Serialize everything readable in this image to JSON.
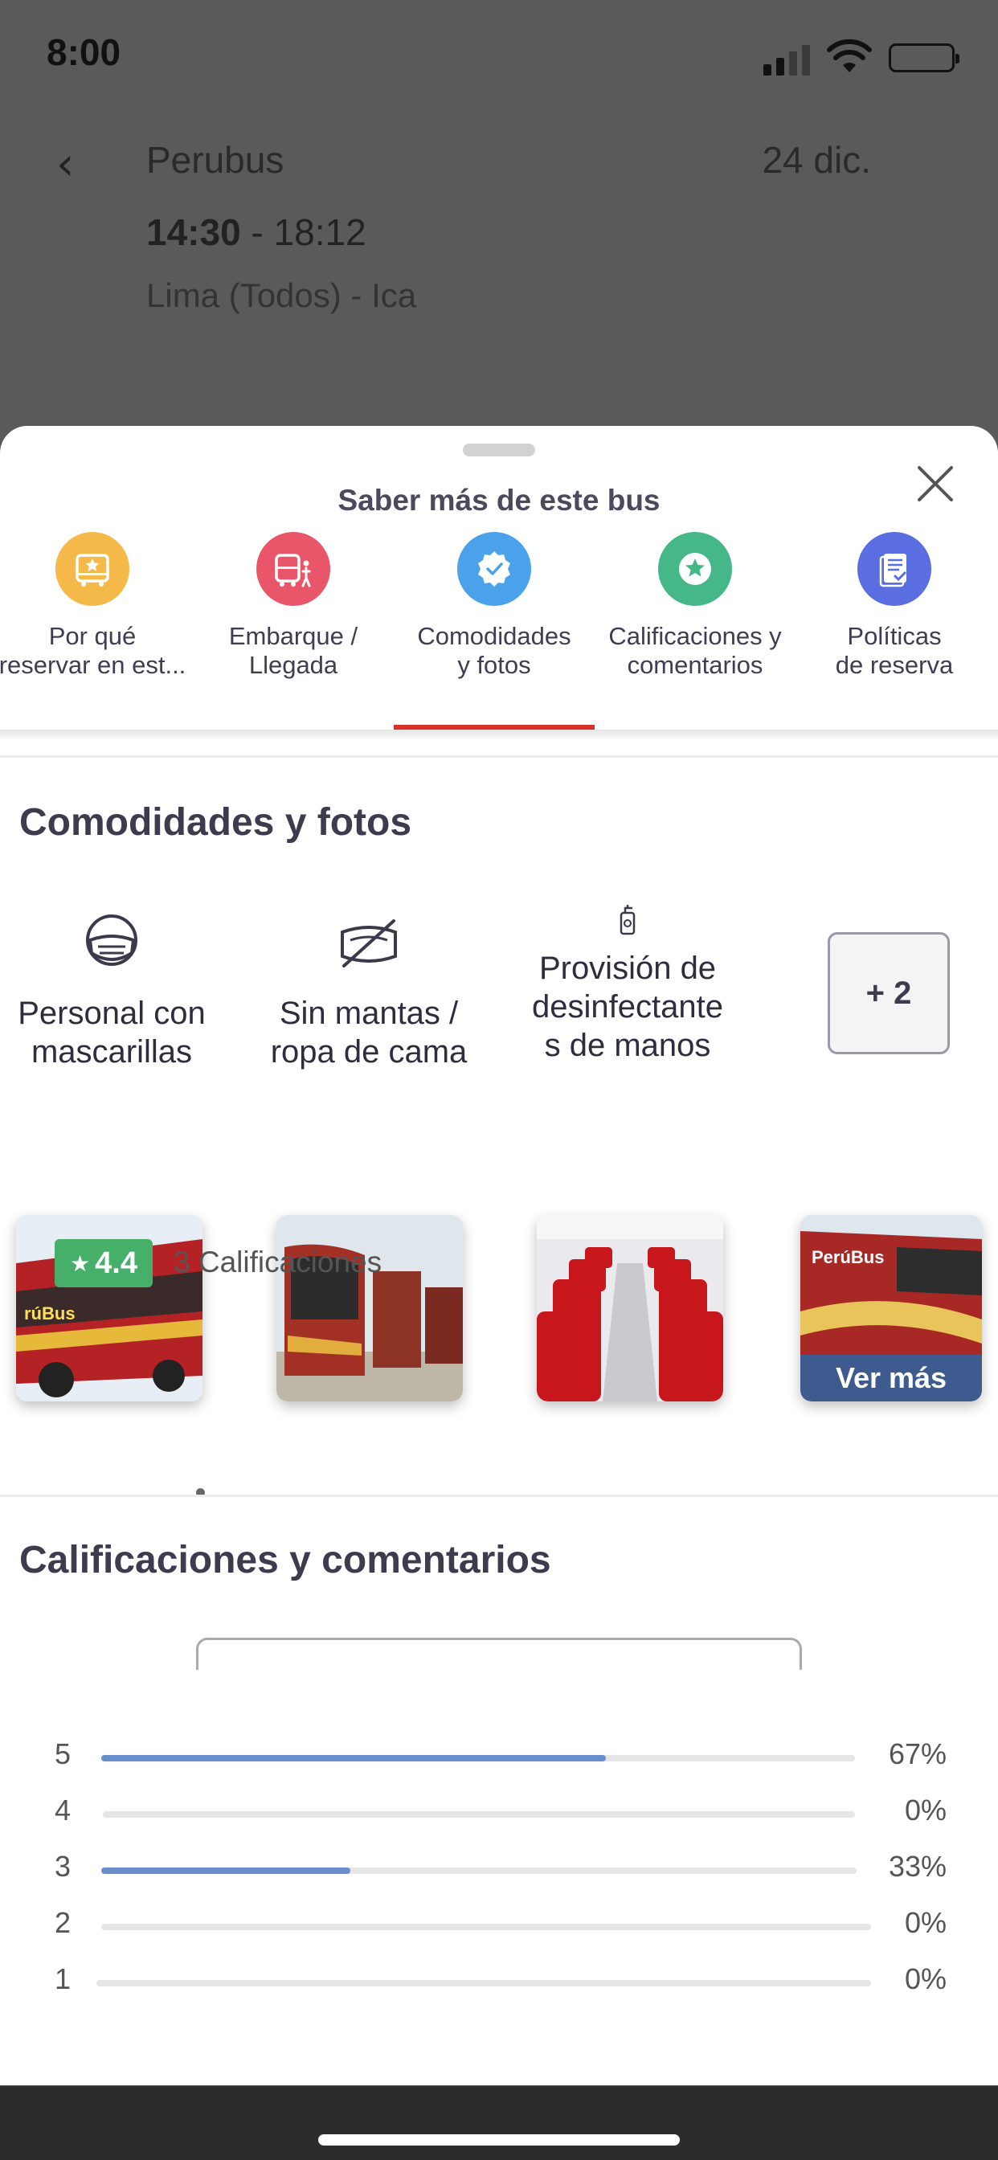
{
  "status_bar": {
    "time": "8:00"
  },
  "header": {
    "operator": "Perubus",
    "date": "24 dic.",
    "departure": "14:30",
    "time_separator": " - ",
    "arrival": "18:12",
    "route": "Lima (Todos) - Ica"
  },
  "sheet": {
    "title": "Saber más de este bus",
    "tabs": [
      {
        "label": "Por qué\nreservar en est...",
        "icon": "bus-star-icon",
        "color": "#f5b94a"
      },
      {
        "label": "Embarque /\nLlegada",
        "icon": "bus-passenger-icon",
        "color": "#e9566a"
      },
      {
        "label": "Comodidades\ny fotos",
        "icon": "verified-badge-icon",
        "color": "#4aa3ea"
      },
      {
        "label": "Calificaciones y\ncomentarios",
        "icon": "star-icon",
        "color": "#46b789"
      },
      {
        "label": "Políticas\nde reserva",
        "icon": "policy-document-icon",
        "color": "#5b6ee1"
      }
    ],
    "active_tab": 2
  },
  "amenities": {
    "title": "Comodidades y fotos",
    "items": [
      {
        "label": "Personal con\nmascarillas",
        "icon": "face-mask-icon"
      },
      {
        "label": "Sin mantas /\nropa de cama",
        "icon": "no-blanket-icon"
      },
      {
        "label": "Provisión de\ndesinfectante\ns de manos",
        "icon": "hand-sanitizer-icon"
      }
    ],
    "more_label": "+ 2",
    "photos_more_label": "Ver más"
  },
  "ratings": {
    "title": "Calificaciones y comentarios",
    "score": "4.4",
    "count_label": "3 Calificaciones",
    "rows": [
      {
        "stars": "5",
        "percent_label": "67%",
        "fraction": 0.67
      },
      {
        "stars": "4",
        "percent_label": "0%",
        "fraction": 0
      },
      {
        "stars": "3",
        "percent_label": "33%",
        "fraction": 0.33
      },
      {
        "stars": "2",
        "percent_label": "0%",
        "fraction": 0
      },
      {
        "stars": "1",
        "percent_label": "0%",
        "fraction": 0
      }
    ],
    "bar_color": "#6a8dcc",
    "badge_color": "#46b06a"
  }
}
